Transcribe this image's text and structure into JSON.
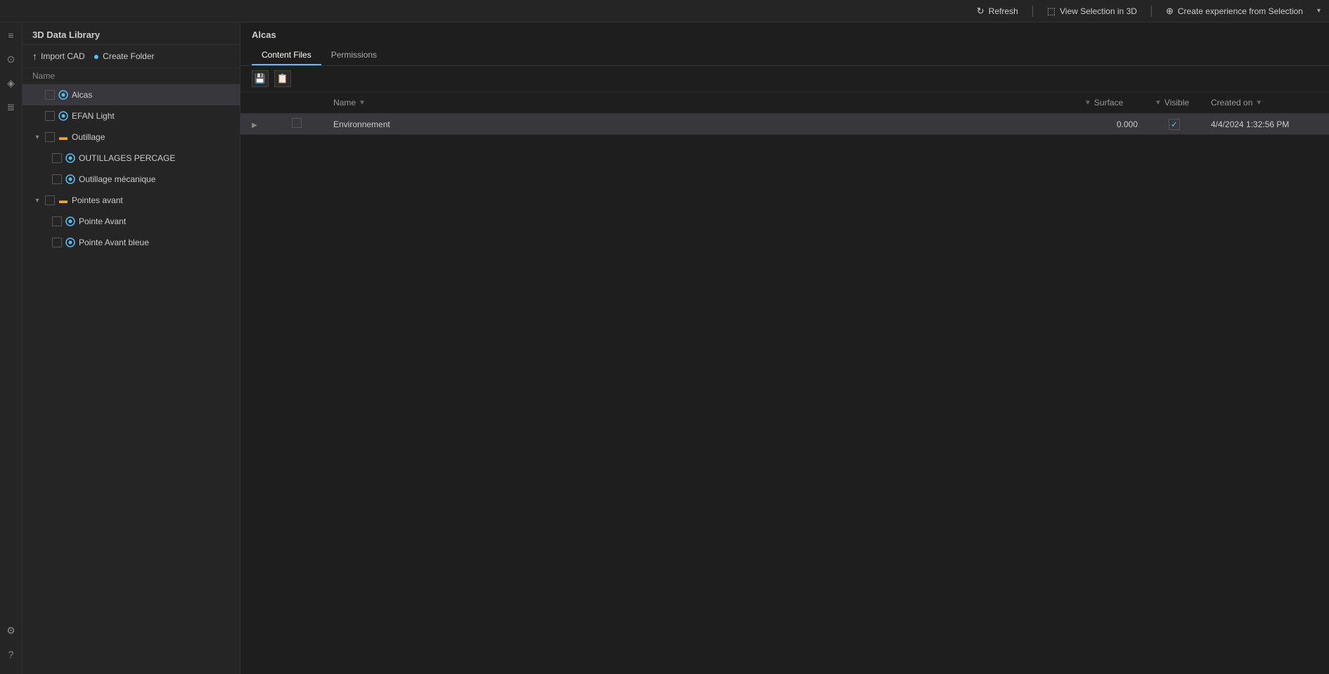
{
  "topbar": {
    "refresh_label": "Refresh",
    "view_selection_label": "View Selection in 3D",
    "create_experience_label": "Create experience from Selection",
    "dropdown_label": "▾"
  },
  "left_panel": {
    "title": "3D Data Library",
    "import_cad_label": "Import CAD",
    "create_folder_label": "Create Folder",
    "name_column": "Name",
    "tree_items": [
      {
        "id": "alcas",
        "label": "Alcas",
        "type": "3d",
        "indent": 0,
        "selected": true,
        "has_expand": false
      },
      {
        "id": "efan-light",
        "label": "EFAN Light",
        "type": "3d",
        "indent": 0,
        "selected": false,
        "has_expand": false
      },
      {
        "id": "outillage",
        "label": "Outillage",
        "type": "folder",
        "indent": 0,
        "selected": false,
        "has_expand": true,
        "expanded": true
      },
      {
        "id": "outillages-percage",
        "label": "OUTILLAGES PERCAGE",
        "type": "3d",
        "indent": 1,
        "selected": false,
        "has_expand": false
      },
      {
        "id": "outillage-mecanique",
        "label": "Outillage mécanique",
        "type": "3d",
        "indent": 1,
        "selected": false,
        "has_expand": false
      },
      {
        "id": "pointes-avant",
        "label": "Pointes avant",
        "type": "folder",
        "indent": 0,
        "selected": false,
        "has_expand": true,
        "expanded": true
      },
      {
        "id": "pointe-avant",
        "label": "Pointe Avant",
        "type": "3d",
        "indent": 1,
        "selected": false,
        "has_expand": false
      },
      {
        "id": "pointe-avant-bleue",
        "label": "Pointe Avant bleue",
        "type": "3d",
        "indent": 1,
        "selected": false,
        "has_expand": false
      }
    ]
  },
  "right_panel": {
    "title": "Alcas",
    "tabs": [
      {
        "id": "content-files",
        "label": "Content Files",
        "active": true
      },
      {
        "id": "permissions",
        "label": "Permissions",
        "active": false
      }
    ],
    "table": {
      "columns": [
        {
          "id": "name",
          "label": "Name"
        },
        {
          "id": "surface",
          "label": "Surface"
        },
        {
          "id": "visible",
          "label": "Visible"
        },
        {
          "id": "created",
          "label": "Created on"
        }
      ],
      "rows": [
        {
          "id": "environnement",
          "name": "Environnement",
          "surface": "0.000",
          "visible": true,
          "created": "4/4/2024 1:32:56 PM",
          "has_expand": true,
          "selected": true
        }
      ]
    }
  },
  "rail_icons": [
    "≡",
    "⊙",
    "♦",
    "≣"
  ],
  "rail_bottom_icons": [
    "⚙",
    "?"
  ],
  "toolbar_icons": [
    "💾",
    "📋"
  ],
  "icons": {
    "3d": "●",
    "folder": "▶"
  }
}
